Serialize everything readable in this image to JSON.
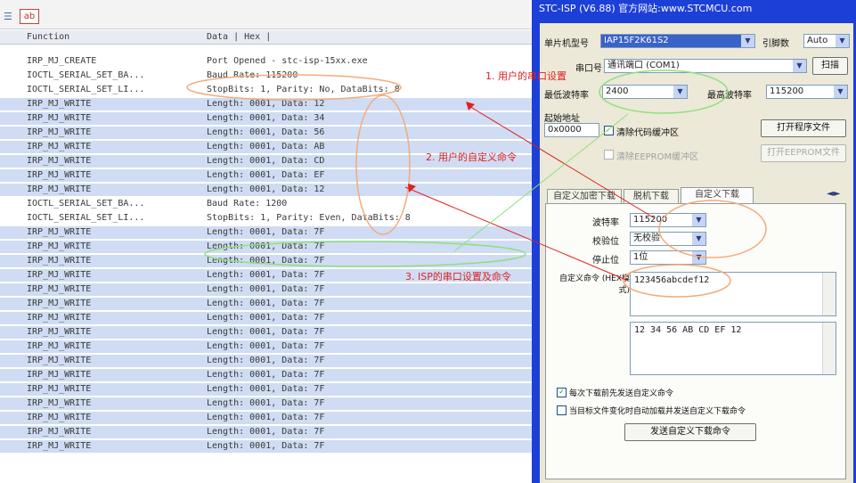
{
  "log": {
    "columns": {
      "function": "Function",
      "data": "Data | Hex |"
    },
    "rows": [
      {
        "fn": "IRP_MJ_CREATE",
        "data": "Port Opened - stc-isp-15xx.exe",
        "selected": false
      },
      {
        "fn": "IOCTL_SERIAL_SET_BA...",
        "data": "Baud Rate: 115200",
        "selected": false
      },
      {
        "fn": "IOCTL_SERIAL_SET_LI...",
        "data": "StopBits: 1, Parity: No, DataBits: 8",
        "selected": false
      },
      {
        "fn": "IRP_MJ_WRITE",
        "data": "Length: 0001, Data: 12",
        "selected": true
      },
      {
        "fn": "IRP_MJ_WRITE",
        "data": "Length: 0001, Data: 34",
        "selected": true
      },
      {
        "fn": "IRP_MJ_WRITE",
        "data": "Length: 0001, Data: 56",
        "selected": true
      },
      {
        "fn": "IRP_MJ_WRITE",
        "data": "Length: 0001, Data: AB",
        "selected": true
      },
      {
        "fn": "IRP_MJ_WRITE",
        "data": "Length: 0001, Data: CD",
        "selected": true
      },
      {
        "fn": "IRP_MJ_WRITE",
        "data": "Length: 0001, Data: EF",
        "selected": true
      },
      {
        "fn": "IRP_MJ_WRITE",
        "data": "Length: 0001, Data: 12",
        "selected": true
      },
      {
        "fn": "IOCTL_SERIAL_SET_BA...",
        "data": "Baud Rate: 1200",
        "selected": false
      },
      {
        "fn": "IOCTL_SERIAL_SET_LI...",
        "data": "StopBits: 1, Parity: Even, DataBits: 8",
        "selected": false
      },
      {
        "fn": "IRP_MJ_WRITE",
        "data": "Length: 0001, Data: 7F",
        "selected": true
      },
      {
        "fn": "IRP_MJ_WRITE",
        "data": "Length: 0001, Data: 7F",
        "selected": true
      },
      {
        "fn": "IRP_MJ_WRITE",
        "data": "Length: 0001, Data: 7F",
        "selected": true
      },
      {
        "fn": "IRP_MJ_WRITE",
        "data": "Length: 0001, Data: 7F",
        "selected": true
      },
      {
        "fn": "IRP_MJ_WRITE",
        "data": "Length: 0001, Data: 7F",
        "selected": true
      },
      {
        "fn": "IRP_MJ_WRITE",
        "data": "Length: 0001, Data: 7F",
        "selected": true
      },
      {
        "fn": "IRP_MJ_WRITE",
        "data": "Length: 0001, Data: 7F",
        "selected": true
      },
      {
        "fn": "IRP_MJ_WRITE",
        "data": "Length: 0001, Data: 7F",
        "selected": true
      },
      {
        "fn": "IRP_MJ_WRITE",
        "data": "Length: 0001, Data: 7F",
        "selected": true
      },
      {
        "fn": "IRP_MJ_WRITE",
        "data": "Length: 0001, Data: 7F",
        "selected": true
      },
      {
        "fn": "IRP_MJ_WRITE",
        "data": "Length: 0001, Data: 7F",
        "selected": true
      },
      {
        "fn": "IRP_MJ_WRITE",
        "data": "Length: 0001, Data: 7F",
        "selected": true
      },
      {
        "fn": "IRP_MJ_WRITE",
        "data": "Length: 0001, Data: 7F",
        "selected": true
      },
      {
        "fn": "IRP_MJ_WRITE",
        "data": "Length: 0001, Data: 7F",
        "selected": true
      },
      {
        "fn": "IRP_MJ_WRITE",
        "data": "Length: 0001, Data: 7F",
        "selected": true
      },
      {
        "fn": "IRP_MJ_WRITE",
        "data": "Length: 0001, Data: 7F",
        "selected": true
      }
    ]
  },
  "isp": {
    "title": "STC-ISP (V6.88) 官方网站:www.STCMCU.com",
    "chip_label": "单片机型号",
    "chip_value": "IAP15F2K61S2",
    "pins_label": "引脚数",
    "pins_value": "Auto",
    "port_label": "串口号",
    "port_value": "通讯端口 (COM1)",
    "scan_button": "扫描",
    "min_baud_label": "最低波特率",
    "min_baud_value": "2400",
    "max_baud_label": "最高波特率",
    "max_baud_value": "115200",
    "start_addr_label": "起始地址",
    "start_addr_value": "0x0000",
    "clear_code_label": "清除代码缓冲区",
    "open_prog_button": "打开程序文件",
    "clear_eeprom_label": "清除EEPROM缓冲区",
    "open_eeprom_button": "打开EEPROM文件",
    "tabs": [
      "自定义加密下载",
      "脱机下载",
      "自定义下载"
    ],
    "active_tab": 2,
    "baud_label": "波特率",
    "baud_value": "115200",
    "parity_label": "校验位",
    "parity_value": "无校验",
    "stop_label": "停止位",
    "stop_value": "1位",
    "cmd_label": "自定义命令 (HEX模式)",
    "cmd_value": "123456abcdef12",
    "hex_preview": "12 34 56 AB CD EF 12",
    "chk_before_label": "每次下载前先发送自定义命令",
    "chk_before": true,
    "chk_auto_label": "当目标文件变化时自动加载并发送自定义下载命令",
    "chk_auto": false,
    "send_button": "发送自定义下载命令"
  },
  "annotations": {
    "note1": "1. 用户的串口设置",
    "note2": "2. 用户的自定义命令",
    "note3": "3. ISP的串口设置及命令"
  },
  "colors": {
    "annotation": "#e02020",
    "ellipse_green": "#8fe07a",
    "ellipse_orange": "#f3ab7c",
    "title_bar": "#1c3fd8",
    "selected_row": "#cfdcf3"
  }
}
